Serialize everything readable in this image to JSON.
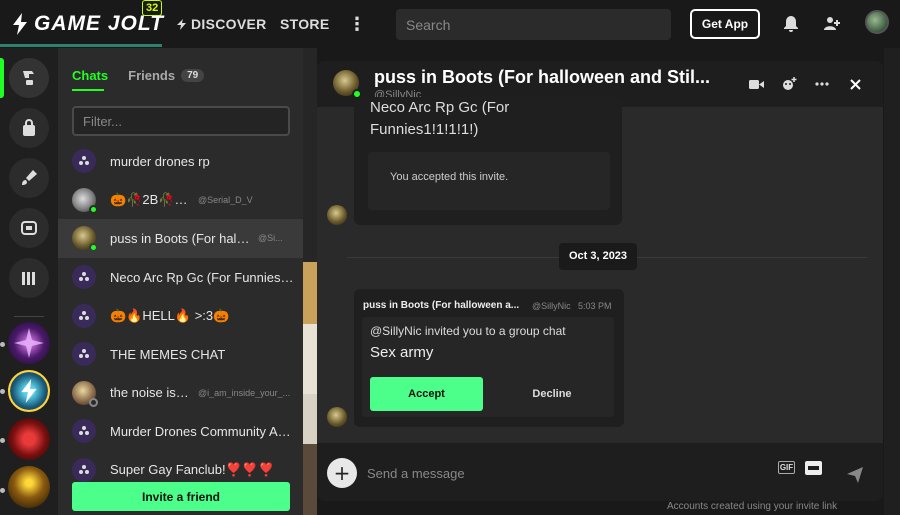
{
  "topbar": {
    "logo_text": "GAME JOLT",
    "notification_count": "32",
    "nav": {
      "discover": "DISCOVER",
      "store": "STORE",
      "more": "⋮"
    },
    "search_placeholder": "Search",
    "get_app_label": "Get App"
  },
  "chatpanel": {
    "tabs": {
      "chats": "Chats",
      "friends": "Friends",
      "friends_count": "79"
    },
    "filter_placeholder": "Filter...",
    "chats": [
      {
        "name": "murder drones rp",
        "user": ""
      },
      {
        "name": "🎃🥀2B🥀🎃",
        "user": "@Serial_D_V"
      },
      {
        "name": "puss in Boots (For hallo...",
        "user": "@Si..."
      },
      {
        "name": "Neco Arc Rp Gc (For Funnies1!...",
        "user": ""
      },
      {
        "name": "🎃🔥HELL🔥 >:3🎃",
        "user": ""
      },
      {
        "name": "THE MEMES CHAT",
        "user": ""
      },
      {
        "name": "the noise is ...",
        "user": "@i_am_inside_your_..."
      },
      {
        "name": "Murder Drones Community Ad...",
        "user": ""
      },
      {
        "name": "Super Gay Fanclub!❣️❣️❣️",
        "user": ""
      }
    ],
    "invite_label": "Invite a friend"
  },
  "chatwin": {
    "title": "puss in Boots (For halloween and Stil...",
    "subtitle": "@SillyNic",
    "message1": {
      "title": "Neco Arc Rp Gc (For Funnies1!1!1!1!)",
      "status": "You accepted this invite."
    },
    "date_divider": "Oct 3, 2023",
    "message2": {
      "sender": "puss in Boots (For halloween a...",
      "user": "@SillyNic",
      "time": "5:03 PM",
      "invite_text": "@SillyNic invited you to a group chat",
      "group_name": "Sex army",
      "accept_label": "Accept",
      "decline_label": "Decline"
    },
    "composer": {
      "placeholder": "Send a message",
      "gif_label": "GIF"
    }
  },
  "footer_note": "Accounts created using your invite link",
  "colors": {
    "accent_green": "#4cff8a",
    "online": "#22ff22",
    "badge": "#ccff00"
  }
}
